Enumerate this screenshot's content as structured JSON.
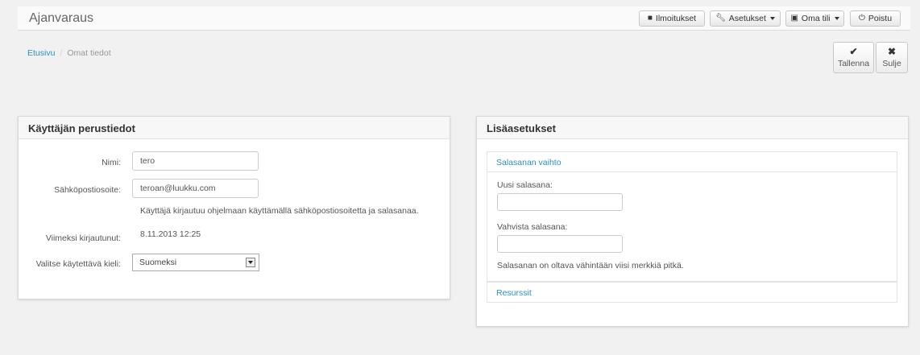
{
  "app": {
    "title": "Ajanvaraus"
  },
  "nav": {
    "notifications": {
      "label": "Ilmoitukset",
      "icon": "comment-icon"
    },
    "settings": {
      "label": "Asetukset",
      "icon": "wrench-icon"
    },
    "account": {
      "label": "Oma tili",
      "icon": "briefcase-icon"
    },
    "logout": {
      "label": "Poistu",
      "icon": "power-icon"
    }
  },
  "breadcrumb": {
    "home": "Etusivu",
    "current": "Omat tiedot"
  },
  "toolbar": {
    "save_label": "Tallenna",
    "close_label": "Sulje"
  },
  "basic_info": {
    "title": "Käyttäjän perustiedot",
    "name_label": "Nimi:",
    "name_value": "tero",
    "email_label": "Sähköpostiosoite:",
    "email_value": "teroan@luukku.com",
    "email_help": "Käyttäjä kirjautuu ohjelmaan käyttämällä sähköpostiosoitetta ja salasanaa.",
    "last_login_label": "Viimeksi kirjautunut:",
    "last_login_value": "8.11.2013 12:25",
    "language_label": "Valitse käytettävä kieli:",
    "language_value": "Suomeksi"
  },
  "extra_settings": {
    "title": "Lisäasetukset",
    "password_section": "Salasanan vaihto",
    "new_password_label": "Uusi salasana:",
    "confirm_password_label": "Vahvista salasana:",
    "password_help": "Salasanan on oltava vähintään viisi merkkiä pitkä.",
    "resources_section": "Resurssit"
  },
  "colors": {
    "link": "#2a8fbd",
    "background": "#f1f1f1",
    "panel": "#ffffff"
  }
}
